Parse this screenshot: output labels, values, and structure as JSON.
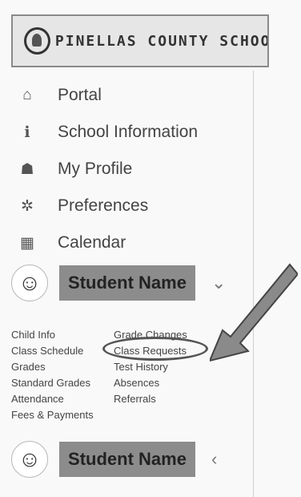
{
  "header": {
    "school_name": "PINELLAS COUNTY SCHOO"
  },
  "nav": {
    "items": [
      {
        "label": "Portal",
        "icon": "home-icon"
      },
      {
        "label": "School Information",
        "icon": "info-icon"
      },
      {
        "label": "My Profile",
        "icon": "user-icon"
      },
      {
        "label": "Preferences",
        "icon": "gear-icon"
      },
      {
        "label": "Calendar",
        "icon": "calendar-icon"
      }
    ]
  },
  "students": [
    {
      "name": "Student Name",
      "expanded": true
    },
    {
      "name": "Student Name",
      "expanded": false
    }
  ],
  "student_links": {
    "col1": [
      "Child Info",
      "Class Schedule",
      "Grades",
      "Standard Grades",
      "Attendance",
      "Fees & Payments"
    ],
    "col2": [
      "Grade Changes",
      "Class Requests",
      "Test History",
      "Absences",
      "Referrals"
    ]
  },
  "annotation": {
    "highlighted_link": "Class Requests"
  }
}
